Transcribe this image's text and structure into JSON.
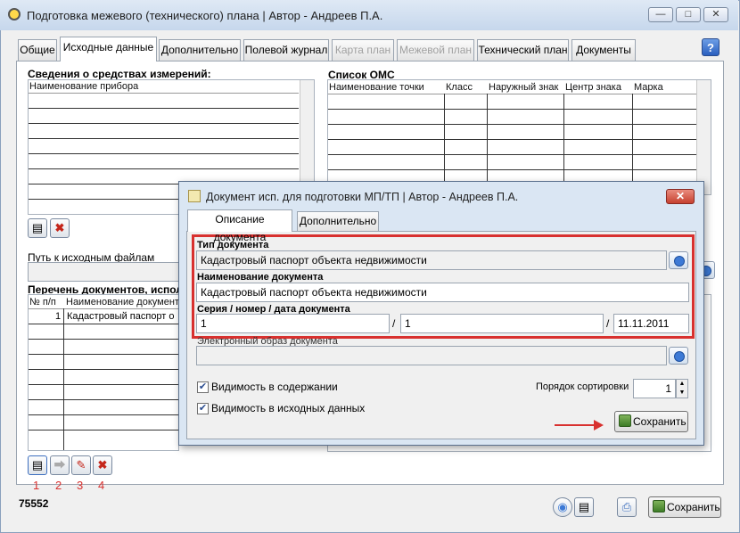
{
  "window": {
    "title": "Подготовка межевого (технического) плана | Автор - Андреев П.А.",
    "minimize": "—",
    "maximize": "□",
    "close": "✕"
  },
  "tabs": [
    {
      "label": "Общие"
    },
    {
      "label": "Исходные данные"
    },
    {
      "label": "Дополнительно"
    },
    {
      "label": "Полевой журнал"
    },
    {
      "label": "Карта план"
    },
    {
      "label": "Межевой план"
    },
    {
      "label": "Технический план"
    },
    {
      "label": "Документы"
    }
  ],
  "help_label": "?",
  "instruments": {
    "title": "Сведения о средствах измерений:",
    "column": "Наименование прибора"
  },
  "oms": {
    "title": "Список ОМС",
    "columns": [
      "Наименование точки",
      "Класс",
      "Наружный знак",
      "Центр знака",
      "Марка"
    ]
  },
  "source_path": {
    "label": "Путь к исходным файлам"
  },
  "doc_list": {
    "title": "Перечень документов, использ",
    "columns": [
      "№ п/п",
      "Наименование документ"
    ],
    "rows": [
      {
        "num": "1",
        "name": "Кадастровый паспорт о"
      }
    ]
  },
  "toolbar_numbers": [
    "1",
    "2",
    "3",
    "4"
  ],
  "footer": {
    "id_value": "75552",
    "save_label": "Сохранить"
  },
  "dialog": {
    "title": "Документ исп. для подготовки МП/ТП | Автор - Андреев П.А.",
    "close": "✕",
    "tabs": [
      "Описание документа",
      "Дополнительно"
    ],
    "doc_type_label": "Тип документа",
    "doc_type_value": "Кадастровый паспорт объекта недвижимости",
    "doc_name_label": "Наименование документа",
    "doc_name_value": "Кадастровый паспорт объекта недвижимости",
    "series_label": "Серия / номер / дата документа",
    "series_value": "1",
    "number_value": "1",
    "date_value": "11.11.2011",
    "separator": "/",
    "image_label": "Электронный образ документа",
    "visible_content_label": "Видимость в содержании",
    "visible_source_label": "Видимость в исходных данных",
    "sort_order_label": "Порядок сортировки",
    "sort_order_value": "1",
    "save_label": "Сохранить",
    "highlight_color": "#d8312f"
  }
}
